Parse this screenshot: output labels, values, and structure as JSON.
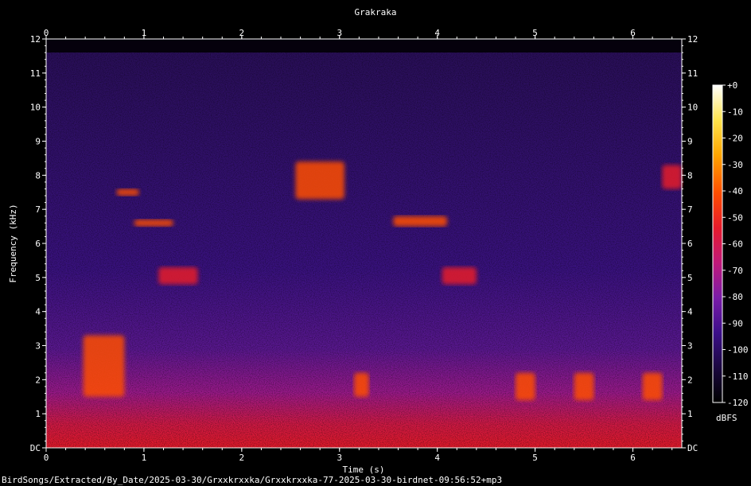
{
  "chart_data": {
    "type": "heatmap",
    "title": "Grakraka",
    "xlabel": "Time (s)",
    "ylabel": "Frequency (kHz)",
    "xlim": [
      0,
      6.5
    ],
    "ylim": [
      0,
      12
    ],
    "x_ticks": [
      "0",
      "1",
      "2",
      "3",
      "4",
      "5",
      "6"
    ],
    "y_ticks": [
      "DC",
      "1",
      "2",
      "3",
      "4",
      "5",
      "6",
      "7",
      "8",
      "9",
      "10",
      "11",
      "12"
    ],
    "colorbar": {
      "unit": "dBFS",
      "min": -120,
      "max": 0,
      "ticks": [
        "+0",
        "-10",
        "-20",
        "-30",
        "-40",
        "-50",
        "-60",
        "-70",
        "-80",
        "-90",
        "-100",
        "-110",
        "-120"
      ],
      "colors": [
        "#000000",
        "#1b0840",
        "#3c0f8a",
        "#7a1ca8",
        "#c0197a",
        "#e61b2c",
        "#ff4e00",
        "#ffa500",
        "#ffe44d",
        "#ffffff"
      ]
    },
    "events": [
      {
        "t0": 0.38,
        "t1": 0.8,
        "f0": 1.5,
        "f1": 3.3,
        "level": -35
      },
      {
        "t0": 0.72,
        "t1": 0.95,
        "f0": 7.4,
        "f1": 7.6,
        "level": -45
      },
      {
        "t0": 0.9,
        "t1": 1.3,
        "f0": 6.5,
        "f1": 6.7,
        "level": -45
      },
      {
        "t0": 1.15,
        "t1": 1.55,
        "f0": 4.8,
        "f1": 5.3,
        "level": -50
      },
      {
        "t0": 2.55,
        "t1": 3.05,
        "f0": 7.3,
        "f1": 8.4,
        "level": -45
      },
      {
        "t0": 3.15,
        "t1": 3.3,
        "f0": 1.5,
        "f1": 2.2,
        "level": -45
      },
      {
        "t0": 3.55,
        "t1": 4.1,
        "f0": 6.5,
        "f1": 6.8,
        "level": -45
      },
      {
        "t0": 4.05,
        "t1": 4.4,
        "f0": 4.8,
        "f1": 5.3,
        "level": -50
      },
      {
        "t0": 4.8,
        "t1": 5.0,
        "f0": 1.4,
        "f1": 2.2,
        "level": -45
      },
      {
        "t0": 5.4,
        "t1": 5.6,
        "f0": 1.4,
        "f1": 2.2,
        "level": -45
      },
      {
        "t0": 6.1,
        "t1": 6.3,
        "f0": 1.4,
        "f1": 2.2,
        "level": -45
      },
      {
        "t0": 6.3,
        "t1": 6.5,
        "f0": 7.6,
        "f1": 8.3,
        "level": -50
      }
    ]
  },
  "footer_path": "BirdSongs/Extracted/By_Date/2025-03-30/Grxxkrxxka/Grxxkrxxka-77-2025-03-30-birdnet-09:56:52+mp3"
}
